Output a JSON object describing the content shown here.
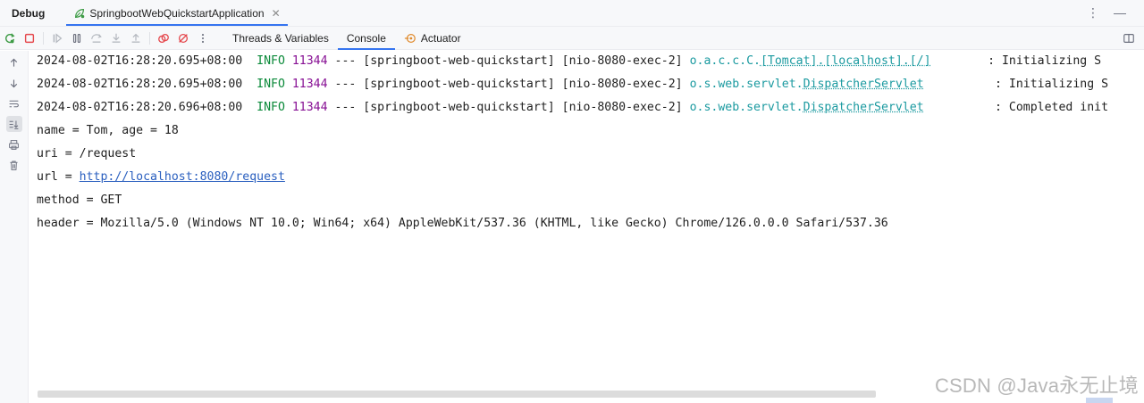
{
  "window": {
    "title": "Debug",
    "run_tab_label": "SpringbootWebQuickstartApplication"
  },
  "toolbar": {
    "tabs": [
      {
        "label": "Threads & Variables"
      },
      {
        "label": "Console"
      },
      {
        "label": "Actuator"
      }
    ],
    "active_tab": "Console"
  },
  "console": {
    "log_lines": [
      {
        "timestamp": "2024-08-02T16:28:20.695+08:00",
        "level": "INFO",
        "pid": "11344",
        "sep": "---",
        "app": "[springboot-web-quickstart]",
        "thread": "[nio-8080-exec-2]",
        "logger_prefix": "o.a.c.c.C.",
        "logger_rest": "[Tomcat].[localhost].[/]",
        "logger_pad": "       ",
        "message": ": Initializing S"
      },
      {
        "timestamp": "2024-08-02T16:28:20.695+08:00",
        "level": "INFO",
        "pid": "11344",
        "sep": "---",
        "app": "[springboot-web-quickstart]",
        "thread": "[nio-8080-exec-2]",
        "logger_prefix": "o.s.web.servlet.",
        "logger_rest": "DispatcherServlet",
        "logger_pad": "         ",
        "message": ": Initializing S"
      },
      {
        "timestamp": "2024-08-02T16:28:20.696+08:00",
        "level": "INFO",
        "pid": "11344",
        "sep": "---",
        "app": "[springboot-web-quickstart]",
        "thread": "[nio-8080-exec-2]",
        "logger_prefix": "o.s.web.servlet.",
        "logger_rest": "DispatcherServlet",
        "logger_pad": "         ",
        "message": ": Completed init"
      }
    ],
    "output_lines": {
      "name_line": "name = Tom, age = 18",
      "uri_line": "uri = /request",
      "url_prefix": "url = ",
      "url_link": "http://localhost:8080/request",
      "method_line": "method = GET",
      "header_line": "header = Mozilla/5.0 (Windows NT 10.0; Win64; x64) AppleWebKit/537.36 (KHTML, like Gecko) Chrome/126.0.0.0 Safari/537.36"
    }
  },
  "watermark": "CSDN @Java永无止境",
  "colors": {
    "accent": "#3574f0",
    "info_level": "#0b8a3a",
    "pid": "#871094",
    "logger": "#1b9aa0",
    "link": "#2a5fbf"
  }
}
